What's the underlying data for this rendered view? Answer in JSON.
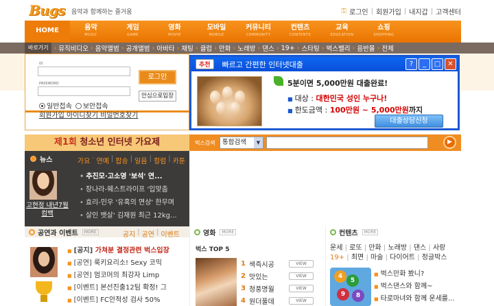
{
  "header": {
    "logo": "Bugs",
    "tagline": "음악과 함께하는 즐거움",
    "links": [
      "로그인",
      "회원가입",
      "내지갑",
      "고객센터"
    ]
  },
  "gnb": [
    {
      "label": "HOME",
      "sub": ""
    },
    {
      "label": "음악",
      "sub": "MUSIC"
    },
    {
      "label": "게임",
      "sub": "GAME"
    },
    {
      "label": "영화",
      "sub": "MOVIE"
    },
    {
      "label": "모바일",
      "sub": "MOBILE"
    },
    {
      "label": "커뮤니티",
      "sub": "COMMUNITY"
    },
    {
      "label": "컨텐츠",
      "sub": "CONTENTS"
    },
    {
      "label": "교육",
      "sub": "EDUCATION"
    },
    {
      "label": "쇼핑",
      "sub": "SHOPPING"
    }
  ],
  "quickbar": {
    "label": "바로가기",
    "items": [
      "뮤직비디오",
      "음악앨범",
      "공개앨범",
      "아바타",
      "채팅",
      "클럽",
      "만화",
      "노래방",
      "댄스",
      "19+",
      "스타팅",
      "벅스밸리",
      "음반몰",
      "전체"
    ]
  },
  "login": {
    "id_label": "ID",
    "pw_label": "PASSWORD",
    "id_value": "",
    "pw_value": "",
    "login_button": "로그인",
    "safe_login": "안심으로입장",
    "radio_normal": "일반접속",
    "radio_secure": "보안접속",
    "links": "회원가입 아이디찾기 비밀번호찾기"
  },
  "ad": {
    "badge": "추천",
    "title": "빠르고 간편한 인터넷대출",
    "headline": "5분이면 5,000만원 대출완료!",
    "target_label": "대상 :",
    "target_value": "대한민국 성인 누구나!",
    "limit_label": "한도금액 :",
    "limit_value": "100만원 ~ 5,000만원",
    "limit_suffix": "까지",
    "apply_button": "대출상담신청"
  },
  "festival": {
    "prefix": "제1회",
    "text": "청소년 인터넷 가요제"
  },
  "search": {
    "label": "벅스검색",
    "category": "통합검색",
    "query": "",
    "go": "▶"
  },
  "news": {
    "title": "뉴스",
    "tabs": [
      "가요",
      "연예",
      "팝송",
      "일음",
      "컬럼",
      "카툰"
    ],
    "thumb_caption": "고현정 내년7월 컴백",
    "items": [
      {
        "text": "추진모·고소영 '보석' 연...",
        "highlight": true
      },
      {
        "text": "장나라-웨스트라이프 '입맞춤",
        "highlight": false
      },
      {
        "text": "효리-민우 '유혹의 면상' 한무며",
        "highlight": false
      },
      {
        "text": "살인 뱃살' 김재원 최근 12kg...",
        "highlight": false
      }
    ]
  },
  "performance": {
    "title": "공연과 이벤트",
    "more": "MORE",
    "tabs": [
      "공지",
      "공연",
      "이벤트"
    ],
    "items": [
      {
        "tag": "[공지]",
        "text": "가쳐분 결정관련 벅스입장",
        "highlight": true
      },
      {
        "tag": "[공연]",
        "text": "룩키요리소! Sexy 코믹",
        "highlight": false
      },
      {
        "tag": "[공연]",
        "text": "멈코머의 최강자 Limp",
        "highlight": false
      },
      {
        "tag": "[이벤트]",
        "text": "본선진출12팀 확정! 그",
        "highlight": false
      },
      {
        "tag": "[이벤트]",
        "text": "FC안적성 검사 50%",
        "highlight": false
      }
    ]
  },
  "movie": {
    "title": "영화",
    "more": "MORE",
    "subtitle": "벅스 TOP 5",
    "view_label": "VIEW",
    "rows": [
      {
        "rank": "1",
        "title": "색즉시공"
      },
      {
        "rank": "2",
        "title": "맛있는"
      },
      {
        "rank": "3",
        "title": "청풍명월"
      },
      {
        "rank": "4",
        "title": "원더풀데"
      }
    ]
  },
  "contents": {
    "title": "컨텐츠",
    "more": "MORE",
    "links_row1": [
      "운세",
      "로또",
      "만화",
      "노래방",
      "댄스",
      "사랑"
    ],
    "links_row2": [
      "19+",
      "최면",
      "마술",
      "다이어트",
      "정글박스"
    ],
    "balls": [
      "4",
      "5",
      "9",
      "8"
    ],
    "items": [
      "벅스만화 봤니?",
      "벅스댄스와 함께~",
      "타로마녀와 함께 운세를..."
    ]
  }
}
